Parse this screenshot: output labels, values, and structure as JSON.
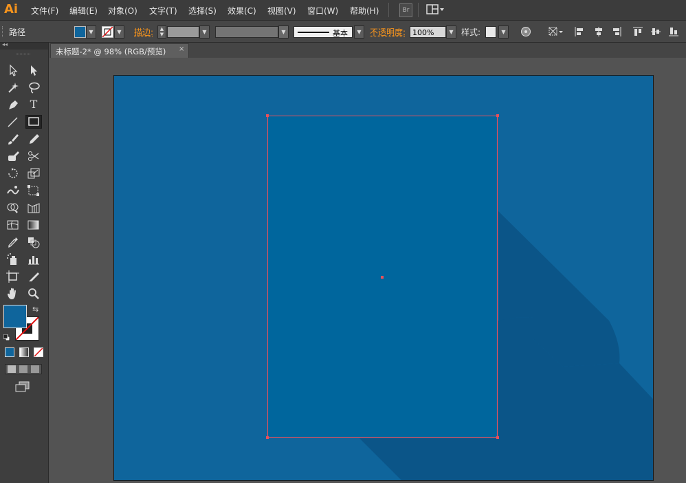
{
  "app": {
    "logo": "Ai"
  },
  "menu": {
    "items": [
      "文件(F)",
      "编辑(E)",
      "对象(O)",
      "文字(T)",
      "选择(S)",
      "效果(C)",
      "视图(V)",
      "窗口(W)",
      "帮助(H)"
    ],
    "bridge_label": "Br",
    "arrange_icon": "layout-icon"
  },
  "control": {
    "object_type": "路径",
    "fill_color": "#0f659c",
    "stroke_label": "描边:",
    "stroke_profile": "基本",
    "opacity_label": "不透明度:",
    "opacity_value": "100%",
    "style_label": "样式:"
  },
  "document": {
    "tab_title": "未标题-2* @ 98% (RGB/预览)",
    "close_symbol": "×"
  },
  "colors": {
    "artboard": "#0f659c",
    "rect_fill": "#00669d",
    "shadow": "#0b5588",
    "selection": "#e8505b",
    "brand": "#f7941d"
  },
  "tools": [
    "selection-tool",
    "direct-selection-tool",
    "magic-wand-tool",
    "lasso-tool",
    "pen-tool",
    "type-tool",
    "line-tool",
    "rectangle-tool",
    "paintbrush-tool",
    "pencil-tool",
    "blob-brush-tool",
    "scissors-tool",
    "rotate-tool",
    "scale-tool",
    "warp-tool",
    "free-transform-tool",
    "shape-builder-tool",
    "perspective-grid-tool",
    "mesh-tool",
    "gradient-tool",
    "eyedropper-tool",
    "blend-tool",
    "symbol-sprayer-tool",
    "column-graph-tool",
    "artboard-tool",
    "slice-tool",
    "hand-tool",
    "zoom-tool"
  ]
}
